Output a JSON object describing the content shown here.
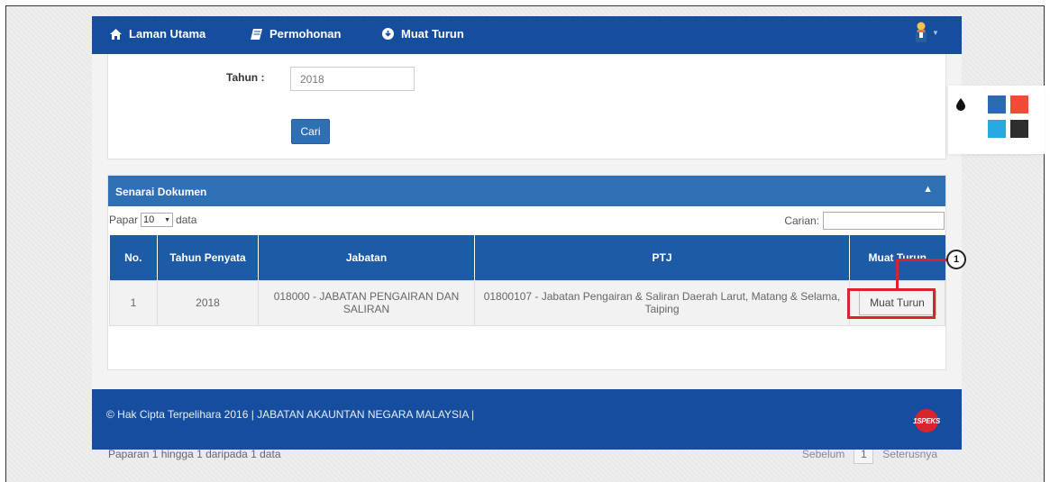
{
  "nav": {
    "items": [
      {
        "label": "Laman Utama",
        "icon": "home-icon"
      },
      {
        "label": "Permohonan",
        "icon": "book-icon"
      },
      {
        "label": "Muat Turun",
        "icon": "download-icon"
      }
    ],
    "avatar_icon": "user-avatar-icon"
  },
  "search": {
    "tahun_label": "Tahun :",
    "tahun_value": "2018",
    "cari_label": "Cari"
  },
  "docs": {
    "title": "Senarai Dokumen",
    "papar_prefix": "Papar",
    "papar_value": "10",
    "papar_suffix": "data",
    "carian_label": "Carian:",
    "columns": [
      "No.",
      "Tahun Penyata",
      "Jabatan",
      "PTJ",
      "Muat Turun"
    ],
    "rows": [
      {
        "no": "1",
        "tahun": "2018",
        "jabatan": "018000 - JABATAN PENGAIRAN DAN SALIRAN",
        "ptj": "01800107 - Jabatan Pengairan & Saliran Daerah Larut, Matang & Selama, Taiping",
        "action": "Muat Turun"
      }
    ],
    "info": "Paparan 1 hingga 1 daripada 1 data",
    "pager": {
      "prev": "Sebelum",
      "page": "1",
      "next": "Seterusnya"
    }
  },
  "callout": {
    "number": "1"
  },
  "footer": {
    "copyright": "© Hak Cipta Terpelihara 2016 | JABATAN AKAUNTAN NEGARA MALAYSIA |",
    "logo_text": "1SPEKS"
  },
  "theme": {
    "swatches": [
      "#2a6ab3",
      "#f04b34",
      "#27a9e1",
      "#2d2d2d"
    ]
  },
  "colors": {
    "primary": "#154e9e",
    "panel_header": "#2f6fb3",
    "highlight": "#d9232d"
  }
}
